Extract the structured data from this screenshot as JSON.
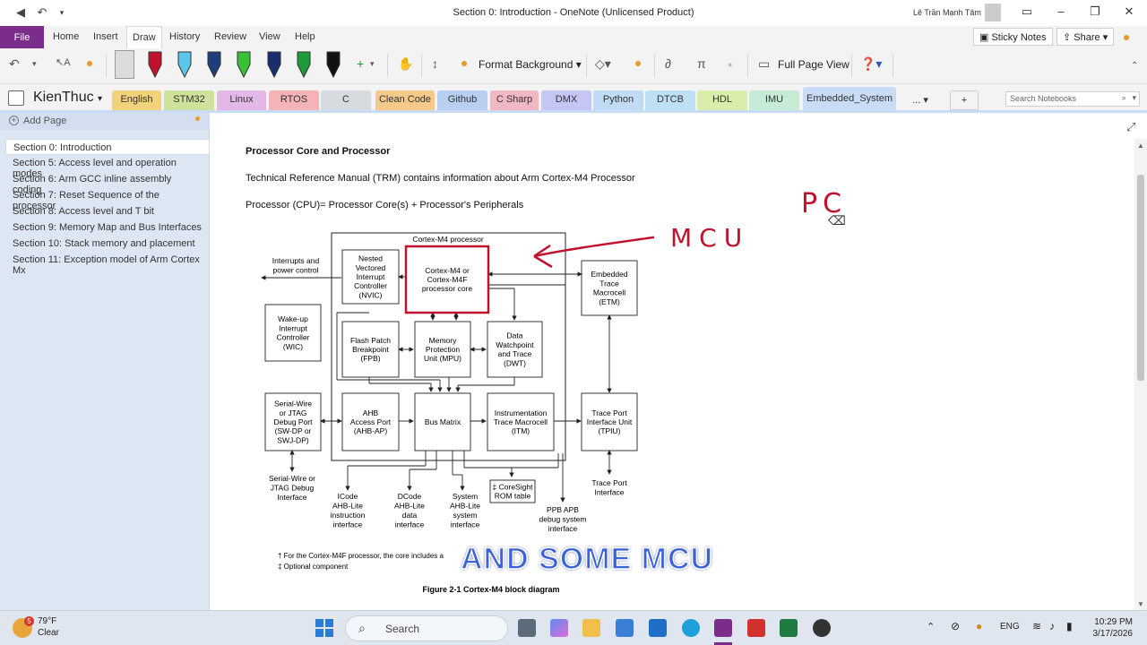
{
  "titlebar": {
    "title": "Section 0: Introduction  -  OneNote (Unlicensed Product)",
    "user_name": "Lê Trần Mạnh Tâm",
    "back_icon": "back-arrow-icon",
    "undo_icon": "undo-icon"
  },
  "menubar": {
    "file": "File",
    "items": [
      "Home",
      "Insert",
      "Draw",
      "History",
      "Review",
      "View",
      "Help"
    ],
    "active": "Draw",
    "sticky_notes": "Sticky Notes",
    "share": "Share"
  },
  "toolbar": {
    "format_background": "Format Background",
    "full_page_view": "Full Page View",
    "pen_colors": [
      "#ffffff",
      "#c0122c",
      "#5cc6e8",
      "#1f3f7a",
      "#38c038",
      "#1a2d6e",
      "#1e9a3a",
      "#111111"
    ]
  },
  "notebook": {
    "name": "KienThuc",
    "search_placeholder": "Search Notebooks",
    "more_label": "...",
    "add_tab": "+",
    "sections": [
      {
        "label": "English",
        "color": "#f2d27a"
      },
      {
        "label": "STM32",
        "color": "#cfe29c"
      },
      {
        "label": "Linux",
        "color": "#e3b7e6"
      },
      {
        "label": "RTOS",
        "color": "#f4b3b7"
      },
      {
        "label": "C",
        "color": "#d7dbe0"
      },
      {
        "label": "Clean Code",
        "color": "#f4c98a"
      },
      {
        "label": "Github",
        "color": "#b8cff2"
      },
      {
        "label": "C Sharp",
        "color": "#f0b7c4"
      },
      {
        "label": "DMX",
        "color": "#c6c6f4"
      },
      {
        "label": "Python",
        "color": "#c2dbf5"
      },
      {
        "label": "DTCB",
        "color": "#bde0f4"
      },
      {
        "label": "HDL",
        "color": "#d8eeaa"
      },
      {
        "label": "IMU",
        "color": "#c6ecd8"
      },
      {
        "label": "Embedded_System",
        "color": "#c9dcf5"
      }
    ]
  },
  "sidebar": {
    "add_page": "Add Page",
    "pages": [
      "Section 0: Introduction",
      "Section 5: Access level and operation modes",
      "Section 6: Arm GCC inline assembly coding",
      "Section 7: Reset Sequence of the processor",
      "Section 8: Access level and T bit",
      "Section 9: Memory Map and Bus Interfaces",
      "Section 10: Stack memory and placement",
      "Section 11: Exception model of Arm Cortex Mx"
    ],
    "selected_index": 0
  },
  "content": {
    "heading": "Processor Core and Processor",
    "line1": "Technical Reference Manual (TRM) contains information about Arm Cortex-M4 Processor",
    "line2": "Processor (CPU)= Processor Core(s) + Processor's Peripherals",
    "handwritten_pc": "PC",
    "handwritten_mcu": "MCU",
    "overlay": "AND SOME MCU",
    "diagram": {
      "outer_label": "Cortex-M4 processor",
      "blocks": {
        "nvic": "Nested|Vectored|Interrupt|Controller|(NVIC)",
        "core": "Cortex-M4 or|Cortex-M4F|processor core",
        "etm": "Embedded|Trace|Macrocell|(ETM)",
        "wic": "Wake-up|Interrupt|Controller|(WIC)",
        "fpb": "Flash Patch|Breakpoint|(FPB)",
        "mpu": "Memory|Protection|Unit (MPU)",
        "dwt": "Data|Watchpoint|and Trace|(DWT)",
        "swj": "Serial-Wire|or JTAG|Debug Port|(SW-DP or|SWJ-DP)",
        "ahbap": "AHB|Access Port|(AHB-AP)",
        "busmatrix": "Bus Matrix",
        "itm": "Instrumentation|Trace Macrocell|(ITM)",
        "tpiu": "Trace Port|Interface Unit|(TPIU)",
        "rom": "‡ CoreSight|ROM table"
      },
      "labels": {
        "interrupts": "Interrupts and|power control",
        "swj_iface": "Serial-Wire or|JTAG Debug|Interface",
        "icode": "ICode|AHB-Lite|instruction|interface",
        "dcode": "DCode|AHB-Lite|data|interface",
        "system": "System|AHB-Lite|system|interface",
        "ppb": "PPB APB|debug system|interface",
        "trace_port": "Trace Port|Interface"
      },
      "footnote1": "† For the Cortex-M4F processor, the core includes a",
      "footnote2": "‡ Optional component",
      "caption": "Figure 2-1 Cortex-M4 block diagram"
    }
  },
  "taskbar": {
    "temperature": "79°F",
    "condition": "Clear",
    "search": "Search",
    "language": "ENG",
    "time": "10:29 PM",
    "date": "3/17/2026",
    "weather_badge": "5"
  }
}
